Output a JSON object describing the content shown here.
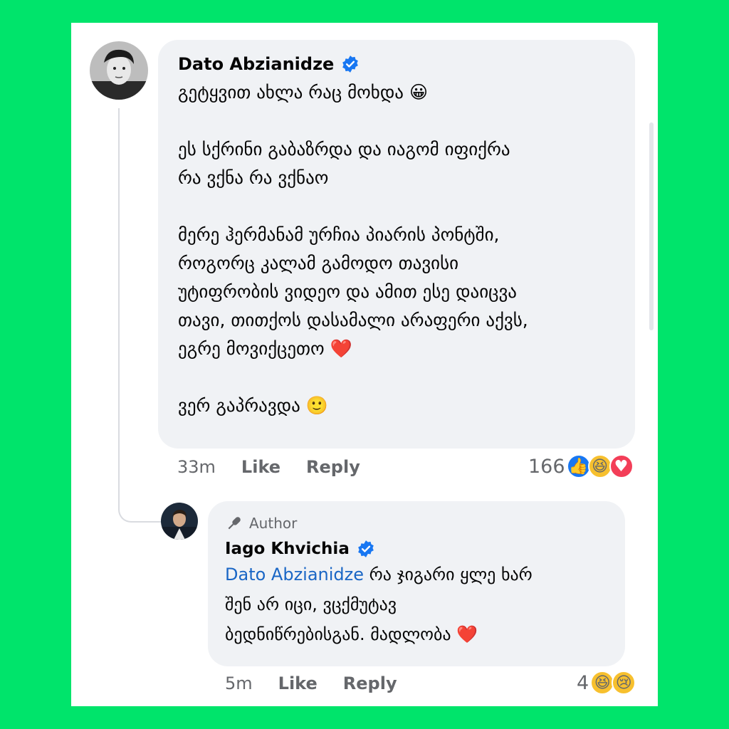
{
  "comment": {
    "author": "Dato Abzianidze",
    "paragraphs": [
      "გეტყვით ახლა რაც მოხდა 😀",
      "ეს სქრინი გაბაზრდა და იაგომ იფიქრა\nრა ვქნა რა ვქნაო",
      "მერე ჰერმანამ ურჩია პიარის პონტში,\nროგორც კალამ გამოდო თავისი\nუტიფრობის ვიდეო და ამით ესე დაიცვა\nთავი, თითქოს დასამალი არაფერი აქვს,\nეგრე მოვიქცეთო ❤️",
      "ვერ გაპრავდა 🙂"
    ],
    "time": "33m",
    "like_label": "Like",
    "reply_label": "Reply",
    "reaction_count": "166",
    "reactions": [
      "👍",
      "😆",
      "♥"
    ]
  },
  "reply": {
    "badge_label": "Author",
    "author": "Iago Khvichia",
    "mention": "Dato Abzianidze",
    "text": " რა ჯიგარი ყლე ხარ\nშენ არ იცი, ვცქმუტავ\nბედნიწრებისგან. მადლობა ❤️",
    "time": "5m",
    "like_label": "Like",
    "reply_label": "Reply",
    "reaction_count": "4",
    "reactions": [
      "😆",
      "😢"
    ]
  },
  "colors": {
    "background": "#00e46b",
    "bubble": "#f0f2f5",
    "mention": "#1a66c5",
    "verified": "#1877f2"
  }
}
